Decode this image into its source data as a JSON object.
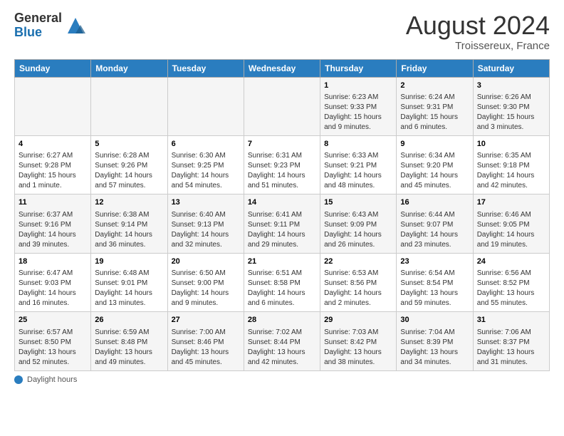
{
  "header": {
    "logo_general": "General",
    "logo_blue": "Blue",
    "month_year": "August 2024",
    "location": "Troissereux, France"
  },
  "footer": {
    "daylight_label": "Daylight hours"
  },
  "weekdays": [
    "Sunday",
    "Monday",
    "Tuesday",
    "Wednesday",
    "Thursday",
    "Friday",
    "Saturday"
  ],
  "weeks": [
    [
      {
        "day": "",
        "info": ""
      },
      {
        "day": "",
        "info": ""
      },
      {
        "day": "",
        "info": ""
      },
      {
        "day": "",
        "info": ""
      },
      {
        "day": "1",
        "info": "Sunrise: 6:23 AM\nSunset: 9:33 PM\nDaylight: 15 hours and 9 minutes."
      },
      {
        "day": "2",
        "info": "Sunrise: 6:24 AM\nSunset: 9:31 PM\nDaylight: 15 hours and 6 minutes."
      },
      {
        "day": "3",
        "info": "Sunrise: 6:26 AM\nSunset: 9:30 PM\nDaylight: 15 hours and 3 minutes."
      }
    ],
    [
      {
        "day": "4",
        "info": "Sunrise: 6:27 AM\nSunset: 9:28 PM\nDaylight: 15 hours and 1 minute."
      },
      {
        "day": "5",
        "info": "Sunrise: 6:28 AM\nSunset: 9:26 PM\nDaylight: 14 hours and 57 minutes."
      },
      {
        "day": "6",
        "info": "Sunrise: 6:30 AM\nSunset: 9:25 PM\nDaylight: 14 hours and 54 minutes."
      },
      {
        "day": "7",
        "info": "Sunrise: 6:31 AM\nSunset: 9:23 PM\nDaylight: 14 hours and 51 minutes."
      },
      {
        "day": "8",
        "info": "Sunrise: 6:33 AM\nSunset: 9:21 PM\nDaylight: 14 hours and 48 minutes."
      },
      {
        "day": "9",
        "info": "Sunrise: 6:34 AM\nSunset: 9:20 PM\nDaylight: 14 hours and 45 minutes."
      },
      {
        "day": "10",
        "info": "Sunrise: 6:35 AM\nSunset: 9:18 PM\nDaylight: 14 hours and 42 minutes."
      }
    ],
    [
      {
        "day": "11",
        "info": "Sunrise: 6:37 AM\nSunset: 9:16 PM\nDaylight: 14 hours and 39 minutes."
      },
      {
        "day": "12",
        "info": "Sunrise: 6:38 AM\nSunset: 9:14 PM\nDaylight: 14 hours and 36 minutes."
      },
      {
        "day": "13",
        "info": "Sunrise: 6:40 AM\nSunset: 9:13 PM\nDaylight: 14 hours and 32 minutes."
      },
      {
        "day": "14",
        "info": "Sunrise: 6:41 AM\nSunset: 9:11 PM\nDaylight: 14 hours and 29 minutes."
      },
      {
        "day": "15",
        "info": "Sunrise: 6:43 AM\nSunset: 9:09 PM\nDaylight: 14 hours and 26 minutes."
      },
      {
        "day": "16",
        "info": "Sunrise: 6:44 AM\nSunset: 9:07 PM\nDaylight: 14 hours and 23 minutes."
      },
      {
        "day": "17",
        "info": "Sunrise: 6:46 AM\nSunset: 9:05 PM\nDaylight: 14 hours and 19 minutes."
      }
    ],
    [
      {
        "day": "18",
        "info": "Sunrise: 6:47 AM\nSunset: 9:03 PM\nDaylight: 14 hours and 16 minutes."
      },
      {
        "day": "19",
        "info": "Sunrise: 6:48 AM\nSunset: 9:01 PM\nDaylight: 14 hours and 13 minutes."
      },
      {
        "day": "20",
        "info": "Sunrise: 6:50 AM\nSunset: 9:00 PM\nDaylight: 14 hours and 9 minutes."
      },
      {
        "day": "21",
        "info": "Sunrise: 6:51 AM\nSunset: 8:58 PM\nDaylight: 14 hours and 6 minutes."
      },
      {
        "day": "22",
        "info": "Sunrise: 6:53 AM\nSunset: 8:56 PM\nDaylight: 14 hours and 2 minutes."
      },
      {
        "day": "23",
        "info": "Sunrise: 6:54 AM\nSunset: 8:54 PM\nDaylight: 13 hours and 59 minutes."
      },
      {
        "day": "24",
        "info": "Sunrise: 6:56 AM\nSunset: 8:52 PM\nDaylight: 13 hours and 55 minutes."
      }
    ],
    [
      {
        "day": "25",
        "info": "Sunrise: 6:57 AM\nSunset: 8:50 PM\nDaylight: 13 hours and 52 minutes."
      },
      {
        "day": "26",
        "info": "Sunrise: 6:59 AM\nSunset: 8:48 PM\nDaylight: 13 hours and 49 minutes."
      },
      {
        "day": "27",
        "info": "Sunrise: 7:00 AM\nSunset: 8:46 PM\nDaylight: 13 hours and 45 minutes."
      },
      {
        "day": "28",
        "info": "Sunrise: 7:02 AM\nSunset: 8:44 PM\nDaylight: 13 hours and 42 minutes."
      },
      {
        "day": "29",
        "info": "Sunrise: 7:03 AM\nSunset: 8:42 PM\nDaylight: 13 hours and 38 minutes."
      },
      {
        "day": "30",
        "info": "Sunrise: 7:04 AM\nSunset: 8:39 PM\nDaylight: 13 hours and 34 minutes."
      },
      {
        "day": "31",
        "info": "Sunrise: 7:06 AM\nSunset: 8:37 PM\nDaylight: 13 hours and 31 minutes."
      }
    ]
  ]
}
